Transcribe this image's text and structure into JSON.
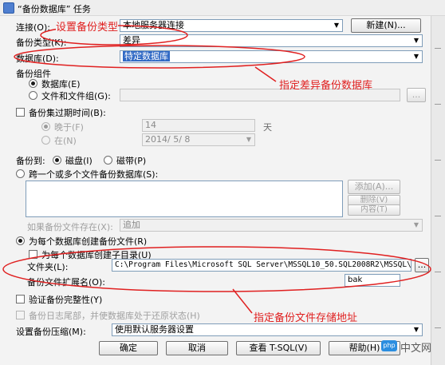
{
  "window": {
    "title": "“备份数据库” 任务"
  },
  "connection": {
    "label": "连接(O):",
    "value": "本地服务器连接",
    "new_button": "新建(N)..."
  },
  "backup_type": {
    "label": "备份类型(K):",
    "value": "差异"
  },
  "database": {
    "label": "数据库(D):",
    "value": "特定数据库"
  },
  "backup_component": {
    "group_label": "备份组件",
    "database_option": "数据库(E)",
    "files_option": "文件和文件组(G):",
    "browse_label": "..."
  },
  "expiry": {
    "checkbox_label": "备份集过期时间(B):",
    "after_label": "晚于(F)",
    "after_value": "14",
    "days_unit": "天",
    "on_label": "在(N)",
    "on_value": "2014/ 5/ 8"
  },
  "backup_to": {
    "label": "备份到:",
    "disk": "磁盘(I)",
    "tape": "磁带(P)"
  },
  "span": {
    "radio_label": "跨一个或多个文件备份数据库(S):",
    "add_button": "添加(A)...",
    "remove_button": "删除(V)",
    "contents_button": "内容(T)",
    "exists_label": "如果备份文件存在(X):",
    "exists_value": "追加"
  },
  "per_db": {
    "radio_label": "为每个数据库创建备份文件(R)",
    "subdir_label": "为每个数据库创建子目录(U)",
    "folder_label": "文件夹(L):",
    "folder_value": "C:\\Program Files\\Microsoft SQL Server\\MSSQL10_50.SQL2008R2\\MSSQL\\",
    "browse_label": "...",
    "ext_label": "备份文件扩展名(O):",
    "ext_value": "bak"
  },
  "verify": {
    "label": "验证备份完整性(Y)"
  },
  "tail_log": {
    "label": "备份日志尾部，并使数据库处于还原状态(H)"
  },
  "compression": {
    "label": "设置备份压缩(M):",
    "value": "使用默认服务器设置"
  },
  "footer": {
    "ok": "确定",
    "cancel": "取消",
    "view_tsql": "查看 T-SQL(V)",
    "help": "帮助(H)"
  },
  "annotations": {
    "set_type": "设置备份类型",
    "specify_db": "指定差异备份数据库",
    "specify_path": "指定备份文件存储地址",
    "color": "#e02020"
  },
  "watermark": {
    "text": "中文网"
  }
}
